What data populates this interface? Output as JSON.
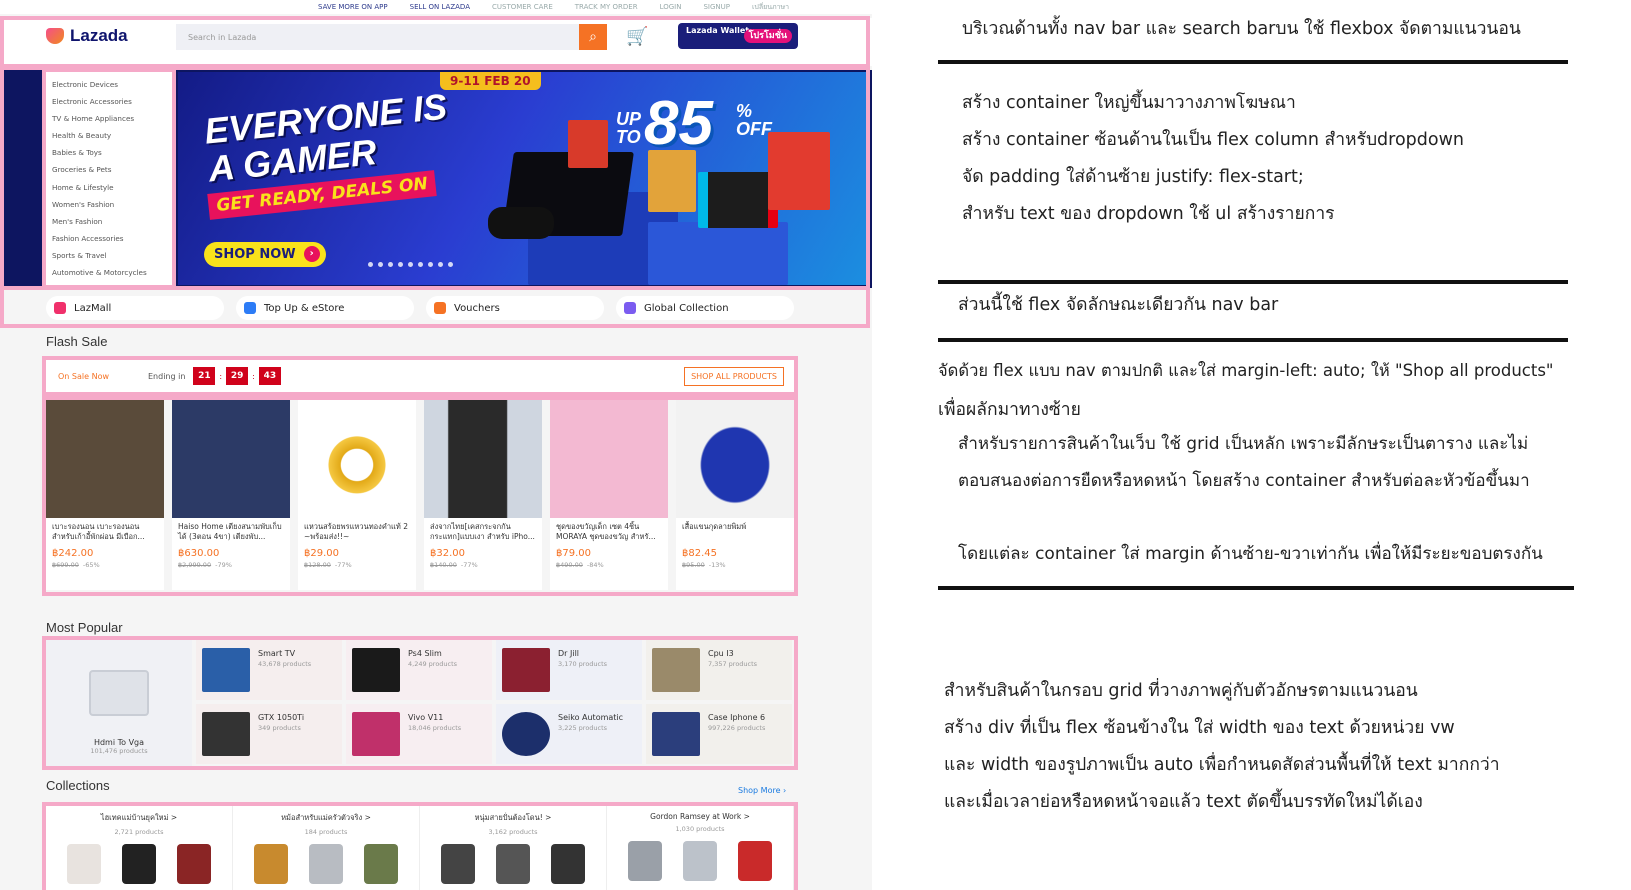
{
  "topbar": [
    "SAVE MORE ON APP",
    "SELL ON LAZADA",
    "CUSTOMER CARE",
    "TRACK MY ORDER",
    "LOGIN",
    "SIGNUP",
    "เปลี่ยนภาษา"
  ],
  "header": {
    "logo": "Lazada",
    "search_placeholder": "Search in Lazada",
    "wallet_title": "Lazada Wallet",
    "wallet_promo": "โปรโมชั่น",
    "accent": "#f57224"
  },
  "categories": [
    "Electronic Devices",
    "Electronic Accessories",
    "TV & Home Appliances",
    "Health & Beauty",
    "Babies & Toys",
    "Groceries & Pets",
    "Home & Lifestyle",
    "Women's Fashion",
    "Men's Fashion",
    "Fashion Accessories",
    "Sports & Travel",
    "Automotive & Motorcycles"
  ],
  "banner": {
    "date": "9-11 FEB 20",
    "line1": "EVERYONE IS",
    "line2": "A GAMER",
    "line3": "GET READY, DEALS ON",
    "cta": "SHOP NOW",
    "upto": "UP TO",
    "pct": "85",
    "off": "% OFF"
  },
  "channels": [
    {
      "label": "LazMall",
      "color": "#f0306b"
    },
    {
      "label": "Top Up & eStore",
      "color": "#2d7cf6"
    },
    {
      "label": "Vouchers",
      "color": "#f57224"
    },
    {
      "label": "Global Collection",
      "color": "#7b5cf0"
    }
  ],
  "flash": {
    "title": "Flash Sale",
    "on_sale": "On Sale Now",
    "ending": "Ending in",
    "h": "21",
    "m": "29",
    "s": "43",
    "shop_all": "SHOP ALL PRODUCTS"
  },
  "products": [
    {
      "name": "เบาะรองนอน เบาะรองนอนสำหรับเก้าอี้พักผ่อน มีเบือก...",
      "price": "฿242.00",
      "old": "฿699.00",
      "disc": "-65%",
      "color": "#5a4b3a"
    },
    {
      "name": "Haiso Home เตียงสนามพับเก็บได้ (3ตอน 4ขา) เตียงพับ...",
      "price": "฿630.00",
      "old": "฿2,999.00",
      "disc": "-79%",
      "color": "#2c3a66"
    },
    {
      "name": "แหวนสร้อยพรแหวนทองคำแท้ 2 ~พร้อมส่ง!!~",
      "price": "฿29.00",
      "old": "฿128.00",
      "disc": "-77%",
      "color": "#e2a917"
    },
    {
      "name": "ส่งจากไทย[เคสกระจกกันกระแทก]แบบเงา สำหรับ iPho...",
      "price": "฿32.00",
      "old": "฿140.00",
      "disc": "-77%",
      "color": "#2a2a2a"
    },
    {
      "name": "ชุดของขวัญเด็ก เซต 4ชิ้น MORAYA ชุดของขวัญ สำหรั...",
      "price": "฿79.00",
      "old": "฿490.00",
      "disc": "-84%",
      "color": "#f3b9d2"
    },
    {
      "name": "เสื้อแขนกุดลายพิมพ์",
      "price": "฿82.45",
      "old": "฿95.00",
      "disc": "-13%",
      "color": "#1f36b0"
    }
  ],
  "popular": {
    "title": "Most Popular",
    "big": {
      "name": "Hdmi To Vga",
      "count": "101,476 products"
    },
    "items": [
      {
        "name": "Smart TV",
        "count": "43,678 products",
        "bg": "#f5eeee",
        "ic": "#2a5fa8"
      },
      {
        "name": "Ps4 Slim",
        "count": "4,249 products",
        "bg": "#f7eef1",
        "ic": "#1a1a1a"
      },
      {
        "name": "Dr Jill",
        "count": "3,170 products",
        "bg": "#eef0f7",
        "ic": "#8b2030"
      },
      {
        "name": "Cpu I3",
        "count": "7,357 products",
        "bg": "#f2f0ec",
        "ic": "#9a8a6a"
      },
      {
        "name": "GTX 1050Ti",
        "count": "349 products",
        "bg": "#f5eeee",
        "ic": "#333"
      },
      {
        "name": "Vivo V11",
        "count": "18,046 products",
        "bg": "#f7eef1",
        "ic": "#c0306a"
      },
      {
        "name": "Seiko Automatic",
        "count": "3,225 products",
        "bg": "#eef0f7",
        "ic": "#1c2f6b"
      },
      {
        "name": "Case Iphone 6",
        "count": "997,226 products",
        "bg": "#f2f0ec",
        "ic": "#2b3e7c"
      }
    ]
  },
  "collections": {
    "title": "Collections",
    "more": "Shop More ›",
    "items": [
      {
        "name": "ไฮเทคแม่บ้านยุคใหม่ >",
        "count": "2,721 products"
      },
      {
        "name": "หม้อสำหรับแม่ครัวตัวจริง >",
        "count": "184 products"
      },
      {
        "name": "หนุ่มสายปั่นต้องโดน! >",
        "count": "3,162 products"
      },
      {
        "name": "Gordon Ramsey at Work >",
        "count": "1,030 products"
      }
    ]
  },
  "notes": [
    "บริเวณด้านทั้ง nav bar และ search barบน ใช้ flexbox จัดตามแนวนอน",
    "สร้าง container ใหญ่ขึ้นมาวางภาพโฆษณา",
    "สร้าง container ซ้อนด้านในเป็น flex column สำหรับdropdown",
    "จัด padding ใส่ด้านซ้าย  justify: flex-start;",
    "สำหรับ text ของ dropdown ใช้ ul สร้างรายการ",
    "ส่วนนี้ใช้ flex จัดลักษณะเดียวกัน nav bar",
    "จัดด้วย flex แบบ nav ตามปกติ และใส่ margin-left: auto; ให้ \"Shop all products\"",
    "เพื่อผลักมาทางซ้าย",
    "สำหรับรายการสินค้าในเว็บ ใช้ grid เป็นหลัก เพราะมีลักษระเป็นตาราง และไม่",
    "ตอบสนองต่อการยืดหรือหดหน้า โดยสร้าง container สำหรับต่อละหัวข้อขึ้นมา",
    "โดยแต่ละ container ใส่ margin ด้านซ้าย-ขวาเท่ากัน เพื่อให้มีระยะขอบตรงกัน",
    "สำหรับสินค้าในกรอบ grid ที่วางภาพคู่กับตัวอักษรตามแนวนอน",
    "สร้าง div ที่เป็น flex ซ้อนข้างใน ใส่ width ของ text ด้วยหน่วย vw",
    "และ width ของรูปภาพเป็น auto เพื่อกำหนดสัดส่วนพื้นที่ให้ text มากกว่า",
    "และเมื่อเวลาย่อหรือหดหน้าจอแล้ว text ตัดขึ้นบรรทัดใหม่ได้เอง"
  ]
}
